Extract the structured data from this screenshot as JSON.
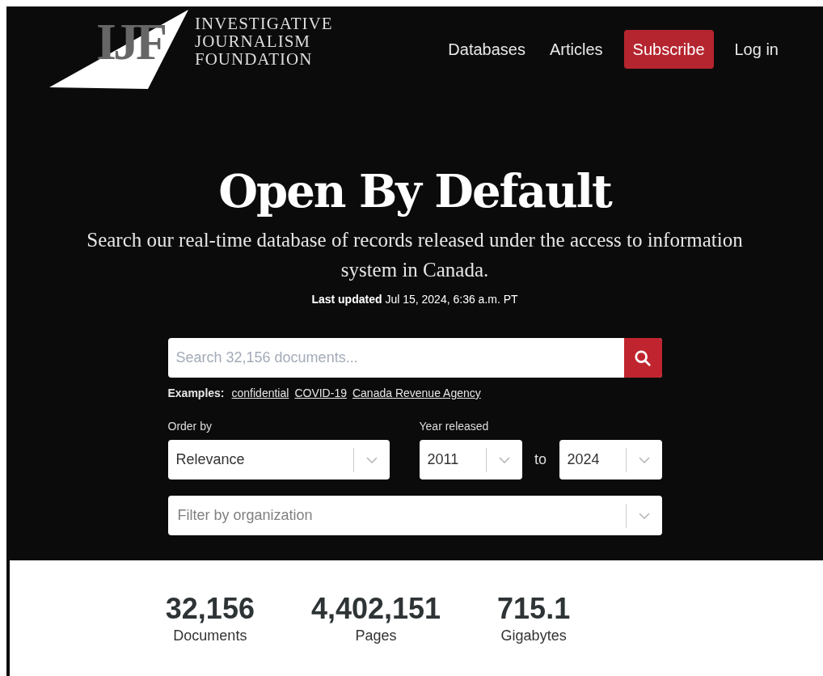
{
  "logo": {
    "mark": "IJF",
    "lines": [
      "INVESTIGATIVE",
      "JOURNALISM",
      "FOUNDATION"
    ]
  },
  "nav": [
    {
      "label": "Databases",
      "kind": "link"
    },
    {
      "label": "Articles",
      "kind": "link"
    },
    {
      "label": "Subscribe",
      "kind": "button"
    },
    {
      "label": "Log in",
      "kind": "link"
    }
  ],
  "hero": {
    "title": "Open By Default",
    "subtitle": "Search our real-time database of records released under the access to information system in Canada.",
    "updated": "**Last updated** Jul 15, 2024, 6:36 a.m. PT"
  },
  "search": {
    "placeholder": "Search 32,156 documents...",
    "examples_label": "Examples:",
    "examples": [
      "confidential",
      "COVID-19",
      "Canada Revenue Agency"
    ]
  },
  "order": {
    "label": "Order by",
    "value": "Relevance"
  },
  "year": {
    "label": "Year released",
    "from": "2011",
    "separator": "to",
    "to": "2024"
  },
  "organization": {
    "placeholder": "Filter by organization"
  },
  "stats": [
    {
      "value": "32,156",
      "label": "Documents"
    },
    {
      "value": "4,402,151",
      "label": "Pages"
    },
    {
      "value": "715.1",
      "label": "Gigabytes"
    }
  ]
}
